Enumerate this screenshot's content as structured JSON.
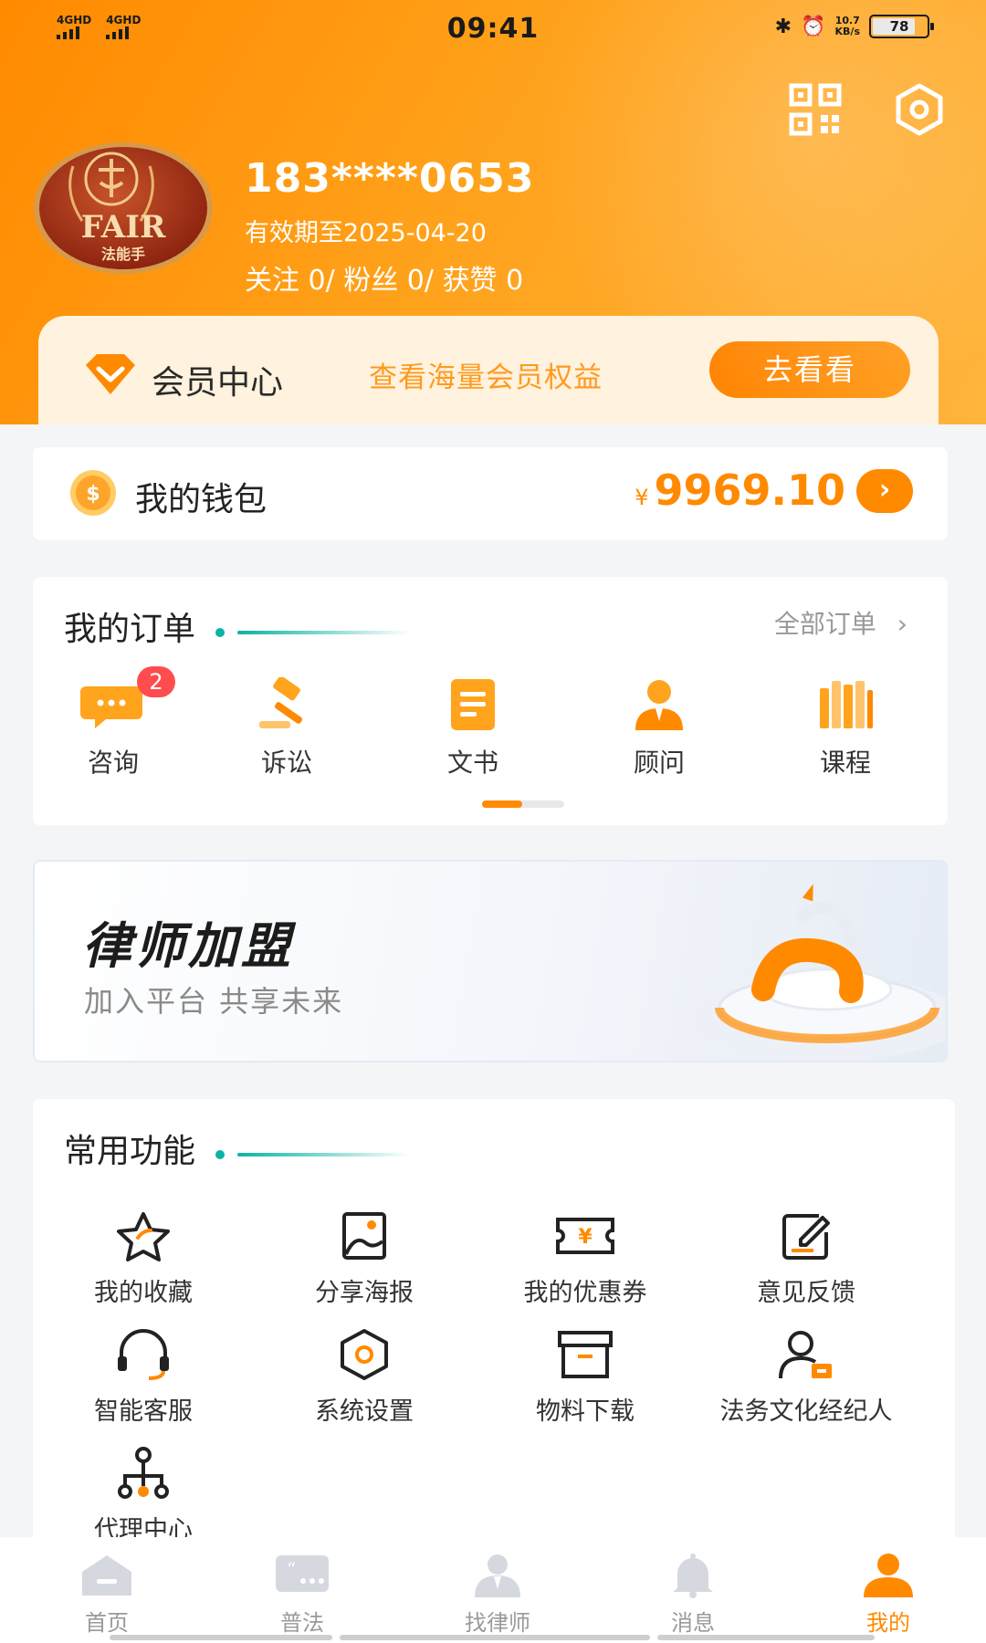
{
  "status_bar": {
    "network_1": "4GHD",
    "network_2": "4GHD",
    "time": "09:41",
    "speed_value": "10.7",
    "speed_unit": "KB/s",
    "battery": "78"
  },
  "header": {
    "qr_icon": "qr-code-icon",
    "settings_icon": "settings-hexagon-icon",
    "avatar_text": "FAIR",
    "avatar_subtext": "法能手",
    "phone": "183****0653",
    "expiry": "有效期至2025-04-20",
    "stats": "关注 0/ 粉丝 0/ 获赞 0"
  },
  "member": {
    "title": "会员中心",
    "desc": "查看海量会员权益",
    "button": "去看看"
  },
  "wallet": {
    "title": "我的钱包",
    "currency": "¥",
    "amount": "9969.10"
  },
  "orders": {
    "title": "我的订单",
    "all_link": "全部订单",
    "items": [
      {
        "label": "咨询",
        "badge": "2",
        "icon": "chat-bubble-icon"
      },
      {
        "label": "诉讼",
        "icon": "gavel-icon"
      },
      {
        "label": "文书",
        "icon": "document-icon"
      },
      {
        "label": "顾问",
        "icon": "advisor-icon"
      },
      {
        "label": "课程",
        "icon": "books-icon"
      }
    ],
    "scroll_progress": 0.5
  },
  "banner": {
    "title": "律师加盟",
    "subtitle": "加入平台 共享未来"
  },
  "functions": {
    "title": "常用功能",
    "items": [
      {
        "label": "我的收藏",
        "icon": "star-icon"
      },
      {
        "label": "分享海报",
        "icon": "poster-icon"
      },
      {
        "label": "我的优惠券",
        "icon": "coupon-icon"
      },
      {
        "label": "意见反馈",
        "icon": "feedback-edit-icon"
      },
      {
        "label": "智能客服",
        "icon": "headset-icon"
      },
      {
        "label": "系统设置",
        "icon": "settings-icon"
      },
      {
        "label": "物料下载",
        "icon": "archive-box-icon"
      },
      {
        "label": "法务文化经纪人",
        "icon": "agent-person-icon"
      },
      {
        "label": "代理中心",
        "icon": "org-tree-icon"
      }
    ]
  },
  "tabbar": {
    "items": [
      {
        "label": "首页",
        "icon": "home-icon"
      },
      {
        "label": "普法",
        "icon": "quote-chat-icon"
      },
      {
        "label": "找律师",
        "icon": "lawyer-icon"
      },
      {
        "label": "消息",
        "icon": "bell-icon"
      },
      {
        "label": "我的",
        "icon": "profile-icon"
      }
    ],
    "active_index": 4
  },
  "colors": {
    "accent": "#ff8a00",
    "teal": "#0bb3a4",
    "badge": "#ff4d4f"
  }
}
